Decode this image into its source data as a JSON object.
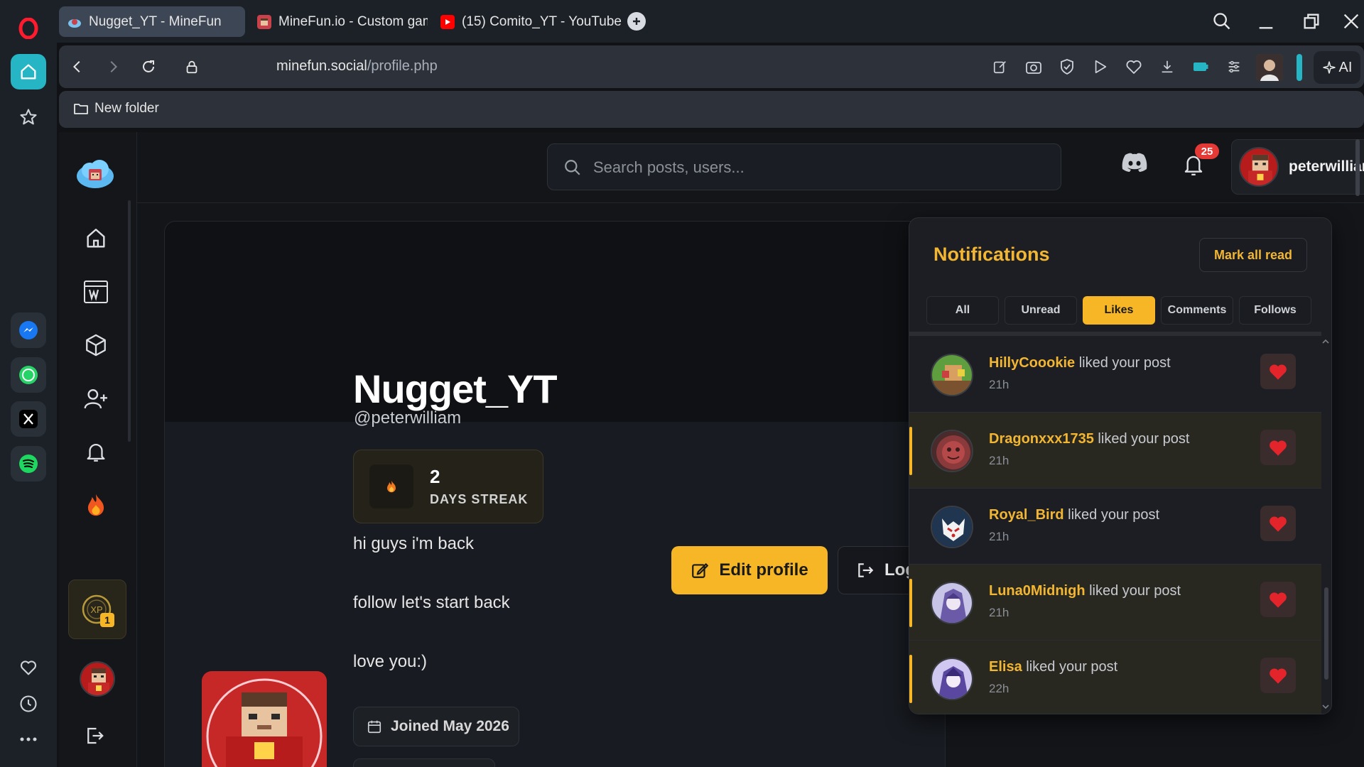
{
  "browser": {
    "tabs": [
      {
        "label": "Nugget_YT - MineFun",
        "active": true,
        "favicon": "minefun-cloud-icon"
      },
      {
        "label": "MineFun.io - Custom gam",
        "active": false,
        "favicon": "minefun-face-icon"
      },
      {
        "label": "(15) Comito_YT - YouTube",
        "active": false,
        "favicon": "youtube-icon"
      }
    ],
    "url_domain": "minefun.social",
    "url_path": "/profile.php",
    "ai_label": "AI",
    "bookmark_folder": "New folder"
  },
  "site": {
    "search_placeholder": "Search posts, users...",
    "notification_count": "25",
    "username": "peterwilliam"
  },
  "profile": {
    "name": "Nugget_YT",
    "handle": "@peterwilliam",
    "streak_value": "2",
    "streak_label": "DAYS STREAK",
    "bio_lines": [
      "hi guys i'm back",
      "follow let's start back",
      "love you:)"
    ],
    "edit_label": "Edit profile",
    "logout_label": "Log out",
    "joined": "Joined May 2026",
    "xp_badge": "1"
  },
  "notifications": {
    "title": "Notifications",
    "mark_all_read": "Mark all read",
    "tabs": [
      "All",
      "Unread",
      "Likes",
      "Comments",
      "Follows"
    ],
    "active_tab": "Likes",
    "items": [
      {
        "user": "HillyCoookie",
        "action": " liked your post",
        "time": "21h",
        "unread": false
      },
      {
        "user": "Dragonxxx1735",
        "action": " liked your post",
        "time": "21h",
        "unread": true
      },
      {
        "user": "Royal_Bird",
        "action": " liked your post",
        "time": "21h",
        "unread": false
      },
      {
        "user": "Luna0Midnigh",
        "action": " liked your post",
        "time": "21h",
        "unread": true
      },
      {
        "user": "Elisa",
        "action": " liked your post",
        "time": "22h",
        "unread": true
      }
    ]
  },
  "colors": {
    "accent": "#f6b625",
    "accent_text": "#f2b632",
    "like_red": "#e3242b",
    "opera_red": "#ff1b2d",
    "home_teal": "#26b5c4"
  }
}
